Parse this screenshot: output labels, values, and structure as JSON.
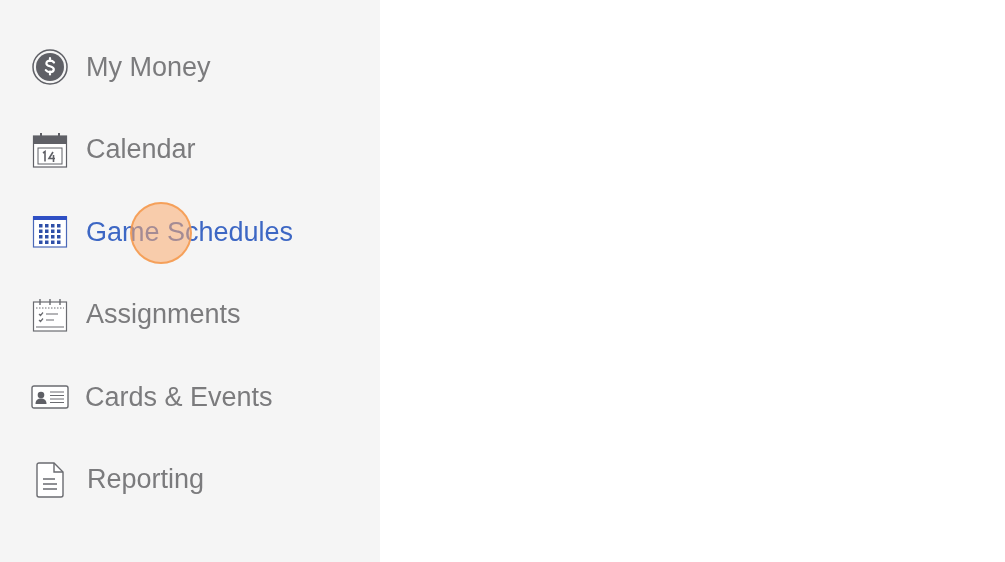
{
  "sidebar": {
    "items": [
      {
        "label": "My Money",
        "selected": false
      },
      {
        "label": "Calendar",
        "selected": false
      },
      {
        "label": "Game Schedules",
        "selected": true
      },
      {
        "label": "Assignments",
        "selected": false
      },
      {
        "label": "Cards & Events",
        "selected": false
      },
      {
        "label": "Reporting",
        "selected": false
      }
    ]
  }
}
